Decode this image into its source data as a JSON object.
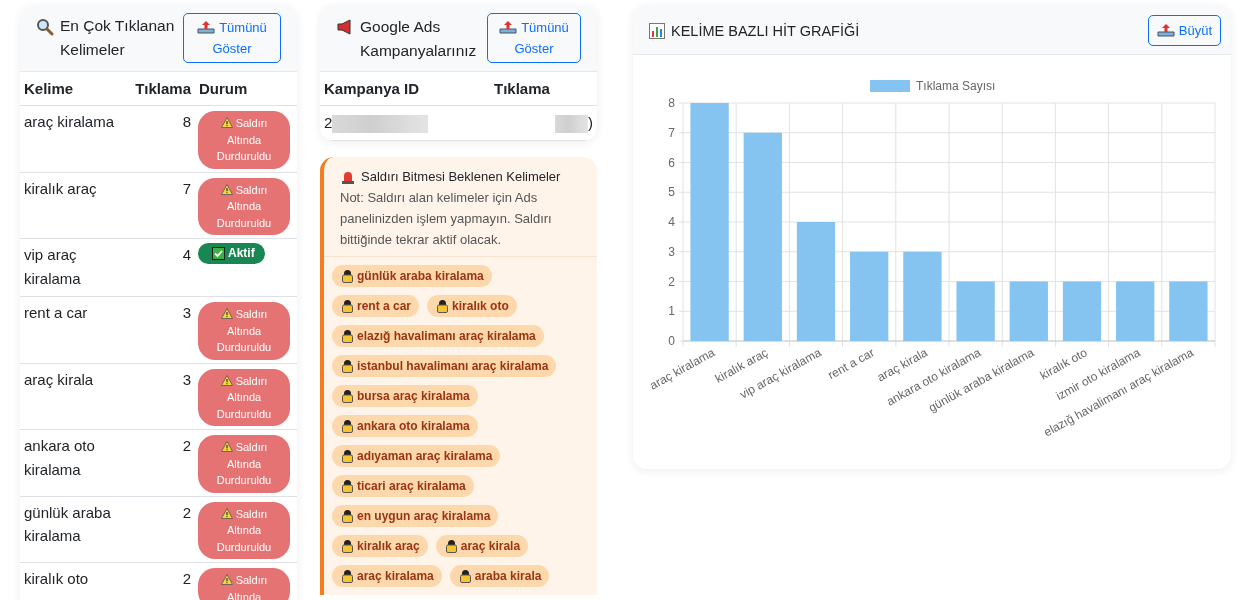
{
  "keywords_card": {
    "title": "En Çok Tıklanan Kelimeler",
    "button": "Tümünü Göster",
    "columns": [
      "Kelime",
      "Tıklama",
      "Durum"
    ],
    "rows": [
      {
        "keyword": "araç kiralama",
        "clicks": "8",
        "kind": "attack",
        "badge": "Saldırı Altında Durduruldu"
      },
      {
        "keyword": "kiralık araç",
        "clicks": "7",
        "kind": "attack",
        "badge": "Saldırı Altında Durduruldu"
      },
      {
        "keyword": "vip araç kiralama",
        "clicks": "4",
        "kind": "active",
        "badge": "Aktif"
      },
      {
        "keyword": "rent a car",
        "clicks": "3",
        "kind": "attack",
        "badge": "Saldırı Altında Durduruldu"
      },
      {
        "keyword": "araç kirala",
        "clicks": "3",
        "kind": "attack",
        "badge": "Saldırı Altında Durduruldu"
      },
      {
        "keyword": "ankara oto kiralama",
        "clicks": "2",
        "kind": "attack",
        "badge": "Saldırı Altında Durduruldu"
      },
      {
        "keyword": "günlük araba kiralama",
        "clicks": "2",
        "kind": "attack",
        "badge": "Saldırı Altında Durduruldu"
      },
      {
        "keyword": "kiralık oto",
        "clicks": "2",
        "kind": "attack",
        "badge": "Saldırı Altında"
      }
    ]
  },
  "campaigns_card": {
    "title": "Google Ads Kampanyalarınız",
    "button": "Tümünü Göster",
    "columns": [
      "Kampanya ID",
      "Tıklama"
    ],
    "rows": [
      {
        "id": "2",
        "clicks": ")"
      }
    ]
  },
  "waiting_card": {
    "title": "Saldırı Bitmesi Beklenen Kelimeler",
    "note": "Not: Saldırı alan kelimeler için Ads panelinizden işlem yapmayın. Saldırı bittiğinde tekrar aktif olacak.",
    "tags": [
      "günlük araba kiralama",
      "rent a car",
      "kiralık oto",
      "elazığ havalimanı araç kiralama",
      "istanbul havalimanı araç kiralama",
      "bursa araç kiralama",
      "ankara oto kiralama",
      "adıyaman araç kiralama",
      "ticari araç kiralama",
      "en uygun araç kiralama",
      "kiralık araç",
      "araç kirala",
      "araç kiralama",
      "araba kirala"
    ]
  },
  "chart_card": {
    "title": "KELİME BAZLI HİT GRAFİĞİ",
    "button": "Büyüt",
    "chart_data": {
      "type": "bar",
      "categories": [
        "araç kiralama",
        "kiralık araç",
        "vip araç kiralama",
        "rent a car",
        "araç kirala",
        "ankara oto kiralama",
        "günlük araba kiralama",
        "kiralık oto",
        "izmir oto kiralama",
        "elazığ havalimanı araç kiralama"
      ],
      "series": [
        {
          "name": "Tıklama Sayısı",
          "color": "#85c4f1",
          "values": [
            8,
            7,
            4,
            3,
            3,
            2,
            2,
            2,
            2,
            2
          ]
        }
      ],
      "ylim": [
        0,
        8
      ],
      "grid": true,
      "yticks": [
        {
          "value": 0,
          "label": "0"
        },
        {
          "value": 1,
          "label": "1"
        },
        {
          "value": 2,
          "label": "2"
        },
        {
          "value": 3,
          "label": "3"
        },
        {
          "value": 4,
          "label": "4"
        },
        {
          "value": 5,
          "label": "5"
        },
        {
          "value": 6,
          "label": "6"
        },
        {
          "value": 7,
          "label": "7"
        },
        {
          "value": 8,
          "label": "8"
        }
      ]
    }
  }
}
